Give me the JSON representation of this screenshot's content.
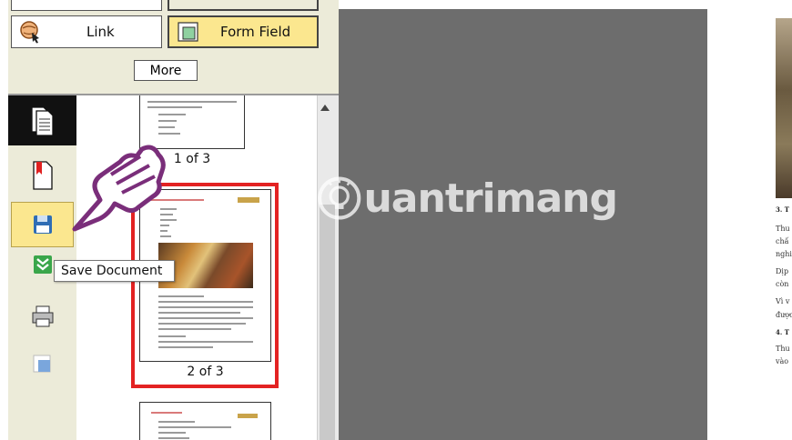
{
  "toolbar": {
    "link_label": "Link",
    "form_field_label": "Form Field",
    "more_label": "More"
  },
  "sidebar": {
    "items": [
      {
        "name": "pages",
        "icon": "pages-icon",
        "active": true
      },
      {
        "name": "bookmarks",
        "icon": "bookmark-icon"
      },
      {
        "name": "save",
        "icon": "floppy-disk-icon",
        "highlighted": true
      },
      {
        "name": "sign",
        "icon": "green-chevron-icon"
      },
      {
        "name": "print",
        "icon": "printer-icon"
      },
      {
        "name": "layers",
        "icon": "layer-icon"
      }
    ],
    "tooltip": "Save Document"
  },
  "thumbnails": {
    "pages": [
      {
        "label": "1 of 3"
      },
      {
        "label": "2 of 3",
        "selected": true
      },
      {
        "label": ""
      }
    ]
  },
  "watermark": {
    "text": "uantrimang"
  },
  "right_document": {
    "lines": [
      "3. T",
      "Thu",
      "chấ",
      "nghi",
      "Dịp",
      "còn",
      "Vì v",
      "được",
      "4. T",
      "Thu",
      "vào"
    ]
  },
  "colors": {
    "selection": "#e32222",
    "highlight": "#fbe78f",
    "viewer_bg": "#6d6d6d",
    "panel_bg": "#ecebd9"
  }
}
